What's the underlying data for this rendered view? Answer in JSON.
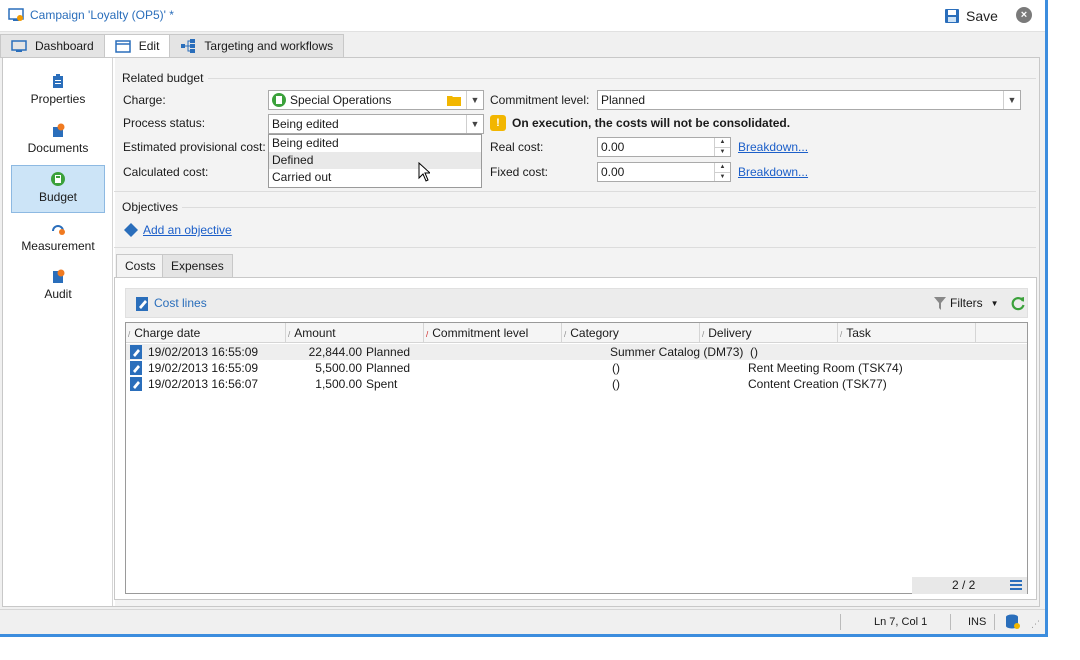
{
  "window": {
    "title": "Campaign 'Loyalty (OP5)' *",
    "save_label": "Save"
  },
  "tabs": [
    {
      "label": "Dashboard"
    },
    {
      "label": "Edit"
    },
    {
      "label": "Targeting and workflows"
    }
  ],
  "nav": {
    "items": [
      {
        "label": "Properties"
      },
      {
        "label": "Documents"
      },
      {
        "label": "Budget"
      },
      {
        "label": "Measurement"
      },
      {
        "label": "Audit"
      }
    ],
    "active": "Budget"
  },
  "budget": {
    "section_label": "Related budget",
    "charge_label": "Charge:",
    "charge_value": "Special Operations",
    "commitment_label": "Commitment level:",
    "commitment_value": "Planned",
    "process_label": "Process status:",
    "process_value": "Being edited",
    "process_options": [
      "Being edited",
      "Defined",
      "Carried out"
    ],
    "warning": "On execution, the costs will not be consolidated.",
    "est_label": "Estimated provisional cost:",
    "calc_label": "Calculated cost:",
    "real_label": "Real cost:",
    "real_value": "0.00",
    "fixed_label": "Fixed cost:",
    "fixed_value": "0.00",
    "breakdown_label": "Breakdown..."
  },
  "objectives": {
    "section_label": "Objectives",
    "add_label": "Add an objective"
  },
  "subtabs": [
    {
      "label": "Costs"
    },
    {
      "label": "Expenses"
    }
  ],
  "cost_lines": {
    "toolbar_label": "Cost lines",
    "filters_label": "Filters",
    "columns": [
      "Charge date",
      "Amount",
      "Commitment level",
      "Category",
      "Delivery",
      "Task"
    ],
    "rows": [
      {
        "date": "19/02/2013 16:55:09",
        "amount": "22,844.00",
        "commitment": "Planned",
        "category": "Summer Catalog (DM73)",
        "delivery": "()",
        "task": ""
      },
      {
        "date": "19/02/2013 16:55:09",
        "amount": "5,500.00",
        "commitment": "Planned",
        "category": "",
        "delivery": "()",
        "task": "Rent Meeting Room (TSK74)"
      },
      {
        "date": "19/02/2013 16:56:07",
        "amount": "1,500.00",
        "commitment": "Spent",
        "category": "",
        "delivery": "()",
        "task": "Content Creation (TSK77)"
      }
    ],
    "pagination": "2 / 2"
  },
  "status": {
    "position": "Ln 7, Col 1",
    "mode": "INS"
  },
  "colors": {
    "accent": "#2a6ebb",
    "window_border": "#3c8dde",
    "nav_active": "#cce4f7",
    "warning": "#f2b600"
  }
}
